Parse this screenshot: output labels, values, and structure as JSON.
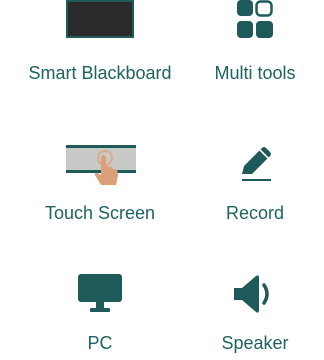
{
  "colors": {
    "icon": "#1e5a5a",
    "label": "#1e6262",
    "blackboard_fill": "#2a2a2a",
    "screen_fill": "#c8cac7",
    "hand_fill": "#d9a07a"
  },
  "tiles": [
    {
      "label": "Smart Blackboard",
      "icon": "blackboard-icon"
    },
    {
      "label": "Multi tools",
      "icon": "multi-tools-icon"
    },
    {
      "label": "Touch Screen",
      "icon": "touch-screen-icon"
    },
    {
      "label": "Record",
      "icon": "pencil-icon"
    },
    {
      "label": "PC",
      "icon": "monitor-icon"
    },
    {
      "label": "Speaker",
      "icon": "speaker-icon"
    }
  ]
}
